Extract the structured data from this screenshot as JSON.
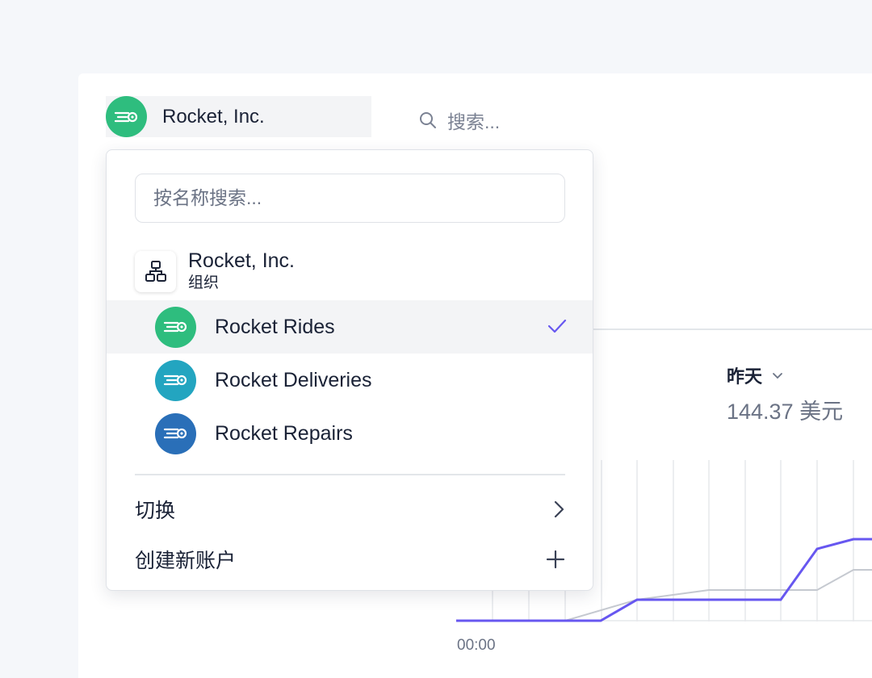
{
  "header": {
    "account_name": "Rocket, Inc.",
    "search_placeholder": "搜索..."
  },
  "dashboard": {
    "range_label": "昨天",
    "range_value": "144.37 美元",
    "time_label": "00:00",
    "chart_color": "#6757f0"
  },
  "dropdown": {
    "filter_placeholder": "按名称搜索...",
    "organization": {
      "name": "Rocket, Inc.",
      "subtitle": "组织"
    },
    "accounts": [
      {
        "label": "Rocket Rides",
        "color": "#2ebd7e",
        "selected": true
      },
      {
        "label": "Rocket Deliveries",
        "color": "#23a5c0",
        "selected": false
      },
      {
        "label": "Rocket Repairs",
        "color": "#2a6fb8",
        "selected": false
      }
    ],
    "switch_label": "切换",
    "create_label": "创建新账户"
  }
}
